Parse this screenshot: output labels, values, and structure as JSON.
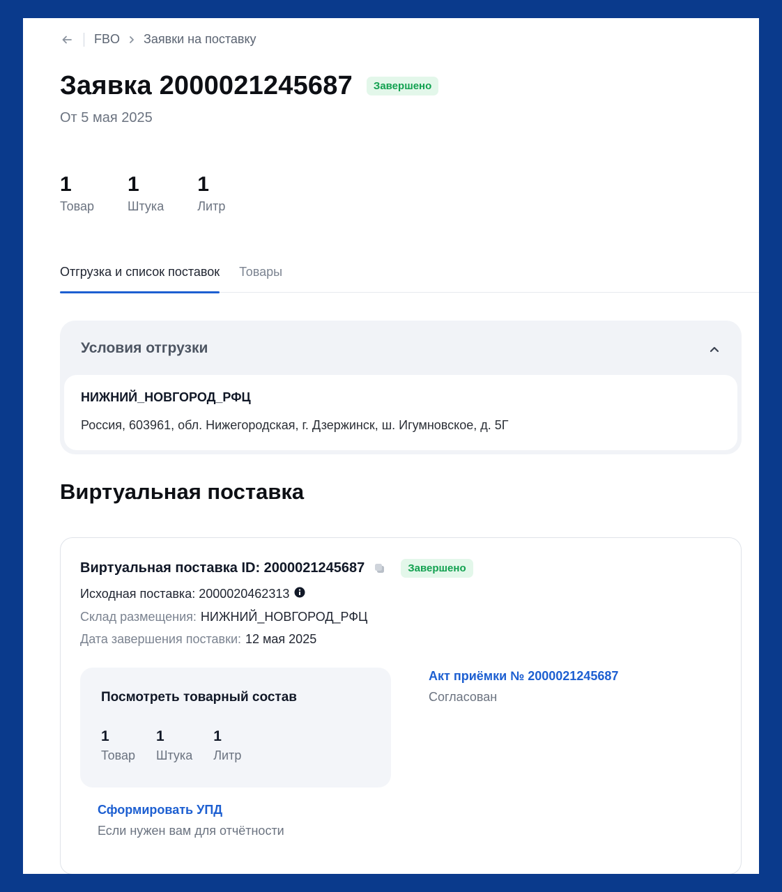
{
  "breadcrumb": {
    "back_icon": "arrow-left-icon",
    "items": [
      "FBO",
      "Заявки на поставку"
    ]
  },
  "header": {
    "title": "Заявка 2000021245687",
    "status": "Завершено",
    "date": "От 5 мая 2025"
  },
  "stats": [
    {
      "value": "1",
      "label": "Товар"
    },
    {
      "value": "1",
      "label": "Штука"
    },
    {
      "value": "1",
      "label": "Литр"
    }
  ],
  "tabs": [
    {
      "label": "Отгрузка и список поставок",
      "active": true
    },
    {
      "label": "Товары",
      "active": false
    }
  ],
  "conditions": {
    "title": "Условия отгрузки",
    "warehouse": "НИЖНИЙ_НОВГОРОД_РФЦ",
    "address": "Россия, 603961, обл. Нижегородская, г. Дзержинск, ш. Игумновское, д. 5Г"
  },
  "virtual": {
    "section_title": "Виртуальная поставка",
    "card_title": "Виртуальная поставка ID: 2000021245687",
    "status": "Завершено",
    "source": "Исходная поставка: 2000020462313",
    "warehouse_label": "Склад размещения:",
    "warehouse_value": "НИЖНИЙ_НОВГОРОД_РФЦ",
    "date_label": "Дата завершения поставки:",
    "date_value": "12 мая 2025",
    "goods": {
      "title": "Посмотреть товарный состав",
      "stats": [
        {
          "value": "1",
          "label": "Товар"
        },
        {
          "value": "1",
          "label": "Штука"
        },
        {
          "value": "1",
          "label": "Литр"
        }
      ]
    },
    "act": {
      "link": "Акт приёмки № 2000021245687",
      "status": "Согласован"
    },
    "upd": {
      "link": "Сформировать УПД",
      "hint": "Если нужен вам для отчётности"
    }
  },
  "colors": {
    "background": "#0a3a8c",
    "accent": "#1d5fd1",
    "success_bg": "#e3f7ea",
    "success_text": "#12a150"
  }
}
